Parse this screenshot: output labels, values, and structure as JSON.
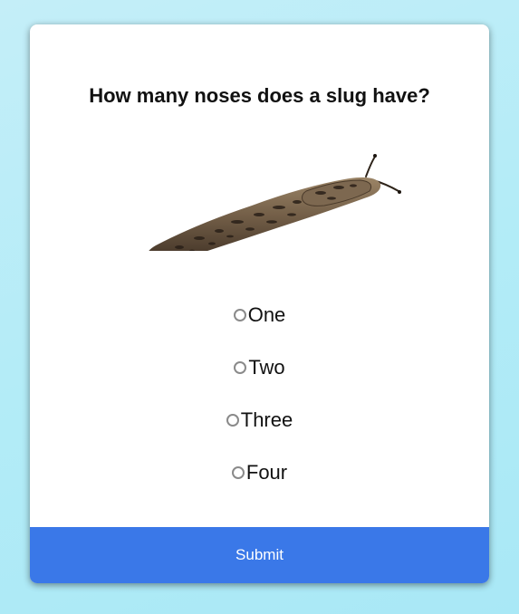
{
  "quiz": {
    "question": "How many noses does a slug have?",
    "image_icon": "slug-photo",
    "options": [
      {
        "label": "One",
        "selected": false
      },
      {
        "label": "Two",
        "selected": false
      },
      {
        "label": "Three",
        "selected": false
      },
      {
        "label": "Four",
        "selected": false
      }
    ],
    "submit_label": "Submit"
  },
  "colors": {
    "background": "#b3ecf7",
    "card": "#ffffff",
    "submit": "#3a78e8",
    "radio_border": "#8a8a8a"
  }
}
